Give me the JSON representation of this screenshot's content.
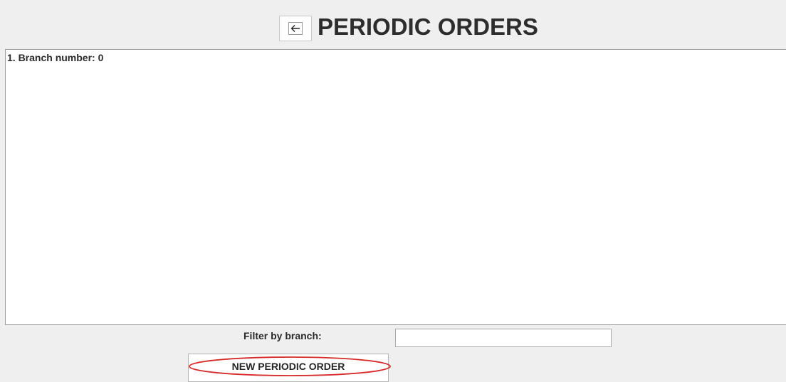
{
  "header": {
    "title": "PERIODIC ORDERS",
    "back_icon": "arrow-left-icon"
  },
  "orders": {
    "items": [
      {
        "label": "1. Branch number: 0"
      }
    ]
  },
  "filter": {
    "label": "Filter by branch:",
    "value": "",
    "placeholder": ""
  },
  "actions": {
    "new_order_label": "NEW PERIODIC ORDER"
  },
  "annotation": {
    "shape": "ellipse",
    "color": "#d62b2b",
    "target": "new-periodic-order-button"
  }
}
